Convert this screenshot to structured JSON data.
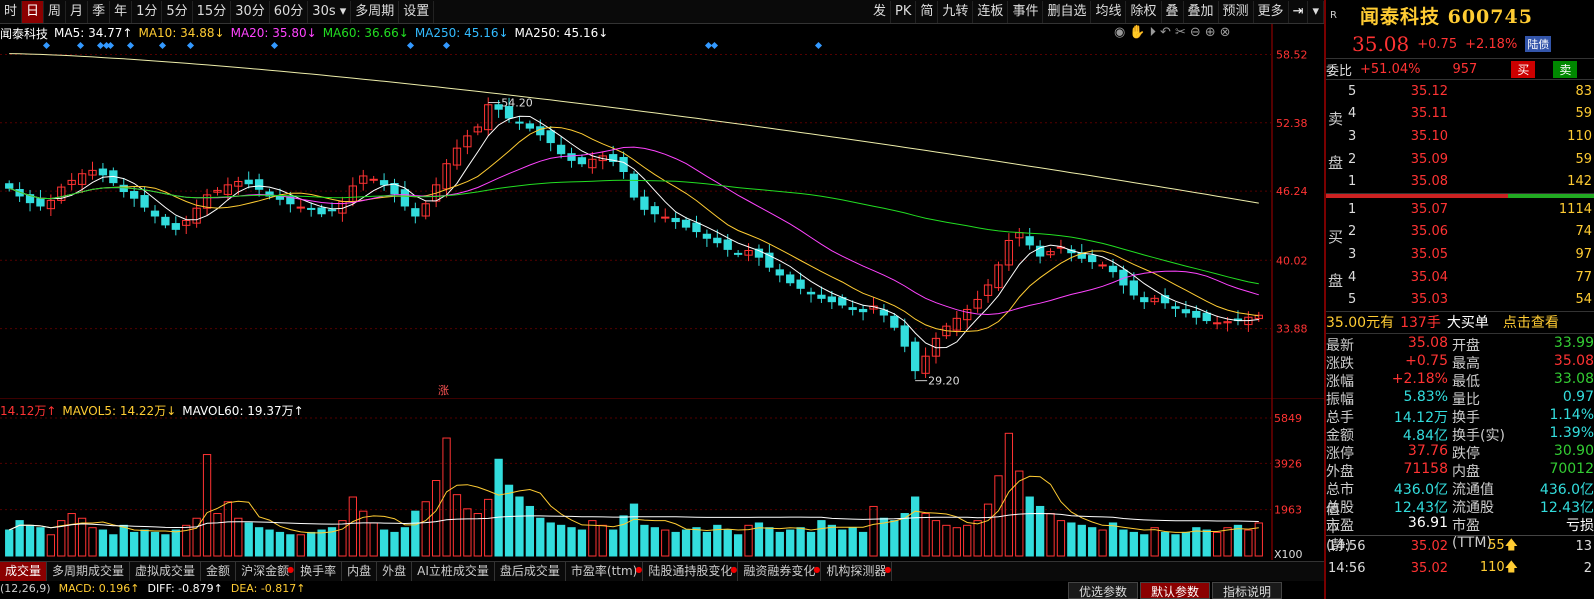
{
  "toolbar": {
    "left": [
      {
        "label": "时",
        "active": false
      },
      {
        "label": "日",
        "active": true
      },
      {
        "label": "周",
        "active": false
      },
      {
        "label": "月",
        "active": false
      },
      {
        "label": "季",
        "active": false
      },
      {
        "label": "年",
        "active": false
      },
      {
        "label": "1分",
        "active": false
      },
      {
        "label": "5分",
        "active": false
      },
      {
        "label": "15分",
        "active": false
      },
      {
        "label": "30分",
        "active": false
      },
      {
        "label": "60分",
        "active": false
      },
      {
        "label": "30s ▾",
        "active": false
      },
      {
        "label": "多周期",
        "active": false
      },
      {
        "label": "设置",
        "active": false
      }
    ],
    "right": [
      "发",
      "PK",
      "简",
      "九转",
      "连板",
      "事件",
      "删自选",
      "均线",
      "除权",
      "叠",
      "叠加",
      "预测",
      "更多"
    ]
  },
  "stock": {
    "name": "闻泰科技",
    "code": "600745",
    "title": "闻泰科技 600745",
    "price": "35.08",
    "change": "+0.75",
    "change_pct": "+2.18%",
    "tag": "陆债"
  },
  "ma_legend": [
    {
      "text": "闻泰科技",
      "color": "#ffffff"
    },
    {
      "text": "MA5: 34.77↑",
      "color": "#ffffff"
    },
    {
      "text": "MA10: 34.88↓",
      "color": "#ffcc33"
    },
    {
      "text": "MA20: 35.80↓",
      "color": "#ff44ff"
    },
    {
      "text": "MA60: 36.66↓",
      "color": "#22dd22"
    },
    {
      "text": "MA250: 45.16↓",
      "color": "#33bbff"
    },
    {
      "text": "MA250: 45.16↓",
      "color": "#ffffff"
    }
  ],
  "vol_legend": [
    {
      "text": "14.12万↑",
      "color": "#ff3333"
    },
    {
      "text": "MAVOL5: 14.22万↓",
      "color": "#ffcc33"
    },
    {
      "text": "MAVOL60: 19.37万↑",
      "color": "#ffffff"
    }
  ],
  "annotations": {
    "high": "54.20",
    "low": "29.20",
    "zhang": "涨"
  },
  "price_axis": [
    "58.52",
    "52.38",
    "46.24",
    "40.02",
    "33.88"
  ],
  "vol_axis": [
    "5849",
    "3926",
    "1963",
    "X100"
  ],
  "tabs": [
    {
      "label": "成交量",
      "active": true,
      "dot": false
    },
    {
      "label": "多周期成交量",
      "active": false,
      "dot": false
    },
    {
      "label": "虚拟成交量",
      "active": false,
      "dot": false
    },
    {
      "label": "金额",
      "active": false,
      "dot": false
    },
    {
      "label": "沪深金额",
      "active": false,
      "dot": true
    },
    {
      "label": "换手率",
      "active": false,
      "dot": false
    },
    {
      "label": "内盘",
      "active": false,
      "dot": false
    },
    {
      "label": "外盘",
      "active": false,
      "dot": false
    },
    {
      "label": "AI立桩成交量",
      "active": false,
      "dot": false
    },
    {
      "label": "盘后成交量",
      "active": false,
      "dot": false
    },
    {
      "label": "市盈率(ttm)",
      "active": false,
      "dot": true
    },
    {
      "label": "陆股通持股变化",
      "active": false,
      "dot": true
    },
    {
      "label": "融资融券变化",
      "active": false,
      "dot": true
    },
    {
      "label": "机构探测器",
      "active": false,
      "dot": true
    }
  ],
  "macd": {
    "prefix": "(12,26,9)",
    "macd": "MACD: 0.196↑",
    "diff": "DIFF: -0.879↑",
    "dea": "DEA: -0.817↑"
  },
  "bottom_buttons": [
    {
      "label": "优选参数",
      "active": false
    },
    {
      "label": "默认参数",
      "active": true
    },
    {
      "label": "指标说明",
      "active": false
    }
  ],
  "weibi": {
    "label": "委比",
    "pct": "+51.04%",
    "diff": "957",
    "sell_btn": "买",
    "buy_btn": "卖"
  },
  "asks": {
    "label": "卖盘",
    "rows": [
      {
        "lv": "5",
        "px": "35.12",
        "qty": "83"
      },
      {
        "lv": "4",
        "px": "35.11",
        "qty": "59"
      },
      {
        "lv": "3",
        "px": "35.10",
        "qty": "110"
      },
      {
        "lv": "2",
        "px": "35.09",
        "qty": "59"
      },
      {
        "lv": "1",
        "px": "35.08",
        "qty": "142"
      }
    ]
  },
  "bids": {
    "label": "买盘",
    "rows": [
      {
        "lv": "1",
        "px": "35.07",
        "qty": "1114"
      },
      {
        "lv": "2",
        "px": "35.06",
        "qty": "74"
      },
      {
        "lv": "3",
        "px": "35.05",
        "qty": "97"
      },
      {
        "lv": "4",
        "px": "35.04",
        "qty": "77"
      },
      {
        "lv": "5",
        "px": "35.03",
        "qty": "54"
      }
    ]
  },
  "big_order": {
    "price": "35.00元有",
    "qty": "137手",
    "label": "大买单",
    "link": "点击查看"
  },
  "stats": [
    {
      "k": "最新",
      "v": "35.08",
      "vc": "red",
      "k2": "开盘",
      "v2": "33.99",
      "v2c": "green"
    },
    {
      "k": "涨跌",
      "v": "+0.75",
      "vc": "red",
      "k2": "最高",
      "v2": "35.08",
      "v2c": "red"
    },
    {
      "k": "涨幅",
      "v": "+2.18%",
      "vc": "red",
      "k2": "最低",
      "v2": "33.08",
      "v2c": "green"
    },
    {
      "k": "振幅",
      "v": "5.83%",
      "vc": "cyan",
      "k2": "量比",
      "v2": "0.97",
      "v2c": "cyan"
    },
    {
      "k": "总手",
      "v": "14.12万",
      "vc": "cyan",
      "k2": "换手",
      "v2": "1.14%",
      "v2c": "cyan"
    },
    {
      "k": "金额",
      "v": "4.84亿",
      "vc": "cyan",
      "k2": "换手(实)",
      "v2": "1.39%",
      "v2c": "cyan"
    },
    {
      "k": "涨停",
      "v": "37.76",
      "vc": "red",
      "k2": "跌停",
      "v2": "30.90",
      "v2c": "green"
    },
    {
      "k": "外盘",
      "v": "71158",
      "vc": "red",
      "k2": "内盘",
      "v2": "70012",
      "v2c": "green"
    },
    {
      "k": "总市值",
      "v": "436.0亿",
      "vc": "cyan",
      "k2": "流通值",
      "v2": "436.0亿",
      "v2c": "cyan"
    },
    {
      "k": "总股本",
      "v": "12.43亿",
      "vc": "cyan",
      "k2": "流通股",
      "v2": "12.43亿",
      "v2c": "cyan"
    },
    {
      "k": "市盈(静)",
      "v": "36.91",
      "vc": "white",
      "k2": "市盈(TTM)",
      "v2": "亏损",
      "v2c": "white"
    }
  ],
  "ticks": [
    {
      "t": "14:56",
      "p": "35.02",
      "q": "55🡅",
      "n": "13"
    },
    {
      "t": "14:56",
      "p": "35.02",
      "q": "110🡅",
      "n": "2"
    }
  ],
  "chart_data": {
    "type": "candlestick",
    "note": "Daily K-line with MA5/MA10/MA20/MA60/MA250 and volume bars",
    "ylim": [
      28,
      60
    ],
    "ma_last": {
      "MA5": 34.77,
      "MA10": 34.88,
      "MA20": 35.8,
      "MA60": 36.66,
      "MA250": 45.16
    },
    "high_label": 54.2,
    "low_label": 29.2,
    "vol_ylim": [
      0,
      5849
    ],
    "candle_closes": [
      46.5,
      45.8,
      45.2,
      44.9,
      45.4,
      46.6,
      47.2,
      47.8,
      48.1,
      47.7,
      47.0,
      46.2,
      45.6,
      44.8,
      44.0,
      43.2,
      42.8,
      43.6,
      44.7,
      45.9,
      46.3,
      46.8,
      47.1,
      46.9,
      46.4,
      45.8,
      45.5,
      45.1,
      44.8,
      44.6,
      44.2,
      44.5,
      45.3,
      46.7,
      47.6,
      47.3,
      46.8,
      46.0,
      44.9,
      44.0,
      45.1,
      46.8,
      48.7,
      50.1,
      51.2,
      52.0,
      54.0,
      53.6,
      52.8,
      52.4,
      51.9,
      51.3,
      50.6,
      49.6,
      49.0,
      48.7,
      49.1,
      49.4,
      48.9,
      48.0,
      45.7,
      44.6,
      44.2,
      43.9,
      43.5,
      43.0,
      42.6,
      42.0,
      41.6,
      41.0,
      40.6,
      40.9,
      40.3,
      39.4,
      38.7,
      38.0,
      37.5,
      37.0,
      36.6,
      36.3,
      36.0,
      35.6,
      35.4,
      35.9,
      35.1,
      34.0,
      32.3,
      30.1,
      31.4,
      33.0,
      34.1,
      34.8,
      35.6,
      36.5,
      37.8,
      39.6,
      41.8,
      42.5,
      41.4,
      40.4,
      40.8,
      41.2,
      40.7,
      40.2,
      39.9,
      39.6,
      39.0,
      37.8,
      36.9,
      36.3,
      36.6,
      36.2,
      35.7,
      35.3,
      34.9,
      34.6,
      34.4,
      34.5,
      34.6,
      34.9,
      35.08
    ],
    "volumes": [
      1100,
      1500,
      1300,
      1200,
      900,
      1500,
      1800,
      1600,
      1200,
      1100,
      900,
      1300,
      1000,
      1100,
      1000,
      900,
      1100,
      1300,
      1600,
      4300,
      1800,
      2300,
      1600,
      1400,
      1200,
      1100,
      1000,
      900,
      900,
      1000,
      1100,
      1200,
      1500,
      2500,
      1900,
      1400,
      1100,
      1000,
      1200,
      1900,
      2300,
      3200,
      5000,
      2600,
      2000,
      1800,
      2400,
      4100,
      3000,
      2500,
      2100,
      1600,
      1400,
      1300,
      1200,
      1100,
      1500,
      1300,
      1100,
      1700,
      2200,
      1300,
      1200,
      1100,
      1000,
      1100,
      1200,
      1000,
      1300,
      1100,
      900,
      1300,
      1400,
      1200,
      1000,
      1100,
      1200,
      1000,
      1500,
      1300,
      1100,
      1200,
      1000,
      2100,
      1600,
      1500,
      1800,
      2500,
      1800,
      1500,
      1300,
      1200,
      1300,
      1500,
      2200,
      3400,
      5200,
      3600,
      2500,
      2100,
      1800,
      1500,
      1400,
      1300,
      1200,
      1100,
      1400,
      1100,
      1000,
      900,
      1200,
      1000,
      900,
      1000,
      1200,
      1100,
      1000,
      1200,
      1300,
      1100,
      1400
    ]
  }
}
